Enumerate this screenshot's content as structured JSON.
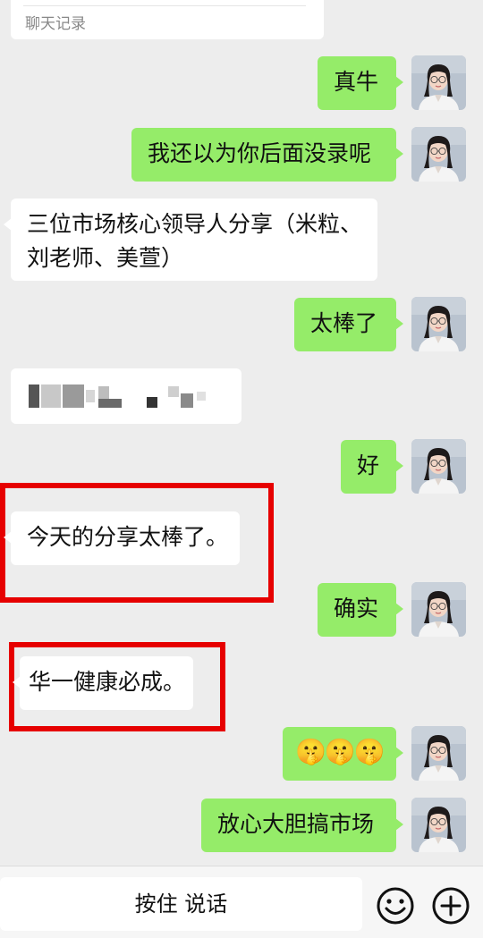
{
  "record_card": {
    "label": "聊天记录"
  },
  "messages": [
    {
      "side": "out",
      "text": "真牛"
    },
    {
      "side": "out",
      "text": "我还以为你后面没录呢"
    },
    {
      "side": "in",
      "lines": [
        "三位市场核心领导人分享（米粒、",
        "刘老师、美萱）"
      ]
    },
    {
      "side": "out",
      "text": "太棒了"
    },
    {
      "side": "in",
      "type": "blurred"
    },
    {
      "side": "out",
      "text": "好"
    },
    {
      "side": "in",
      "text": "今天的分享太棒了。",
      "highlighted": true
    },
    {
      "side": "out",
      "text": "确实"
    },
    {
      "side": "in",
      "text": "华一健康必成。",
      "highlighted": true
    },
    {
      "side": "out",
      "emoji": [
        "🤫",
        "🤫",
        "🤫"
      ]
    },
    {
      "side": "out",
      "text": "放心大胆搞市场"
    }
  ],
  "input_bar": {
    "hold_to_talk": "按住 说话",
    "emoji_icon": "smiley-icon",
    "plus_icon": "plus-icon"
  },
  "colors": {
    "outgoing_bubble": "#95ec69",
    "incoming_bubble": "#ffffff",
    "background": "#ededed",
    "highlight_box": "#e60000"
  }
}
